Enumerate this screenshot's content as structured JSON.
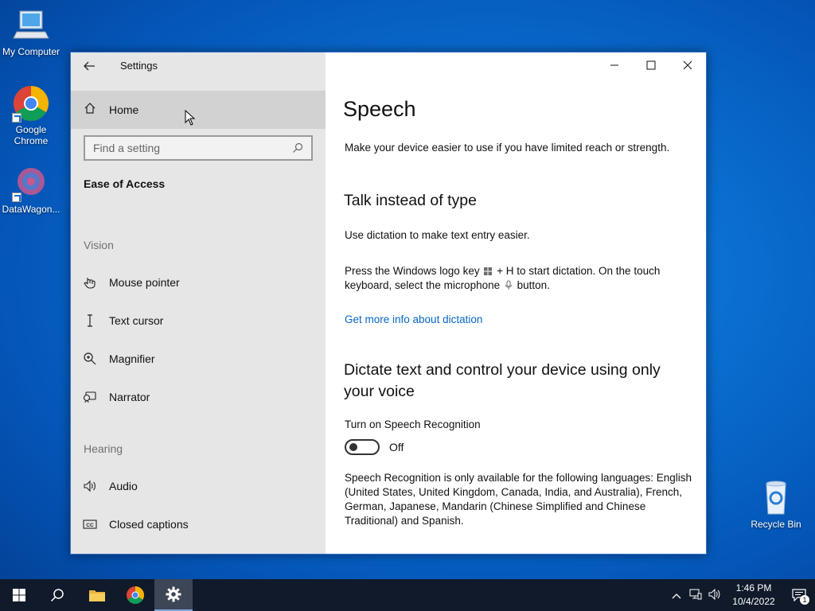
{
  "desktop": {
    "icons": [
      {
        "label": "My Computer",
        "icon": "computer-icon"
      },
      {
        "label": "Google Chrome",
        "icon": "chrome-icon"
      },
      {
        "label": "DataWagon...",
        "icon": "datawagon-icon"
      },
      {
        "label": "Recycle Bin",
        "icon": "recycle-bin-icon"
      }
    ]
  },
  "window": {
    "title": "Settings",
    "controls": [
      "minimize",
      "maximize",
      "close"
    ]
  },
  "sidebar": {
    "home_label": "Home",
    "search_placeholder": "Find a setting",
    "category": "Ease of Access",
    "groups": [
      {
        "label": "Vision",
        "items": [
          {
            "label": "Mouse pointer",
            "icon": "mouse-pointer-icon"
          },
          {
            "label": "Text cursor",
            "icon": "text-cursor-icon"
          },
          {
            "label": "Magnifier",
            "icon": "magnifier-icon"
          },
          {
            "label": "Narrator",
            "icon": "narrator-icon"
          }
        ]
      },
      {
        "label": "Hearing",
        "items": [
          {
            "label": "Audio",
            "icon": "audio-icon"
          },
          {
            "label": "Closed captions",
            "icon": "closed-captions-icon"
          }
        ]
      }
    ]
  },
  "main": {
    "title": "Speech",
    "subtitle": "Make your device easier to use if you have limited reach or strength.",
    "talk_heading": "Talk instead of type",
    "talk_desc": "Use dictation to make text entry easier.",
    "dictation_hint_1": "Press the Windows logo key",
    "dictation_hint_2": "+ H to start dictation.  On the touch keyboard, select the microphone",
    "dictation_hint_3": "button.",
    "dictation_link": "Get more info about dictation",
    "dictate_heading": "Dictate text and control your device using only your voice",
    "speech_recognition_label": "Turn on Speech Recognition",
    "speech_recognition_state": "Off",
    "speech_recognition_on": false,
    "languages_note": "Speech Recognition is only available for the following languages: English (United States, United Kingdom, Canada, India, and Australia), French, German, Japanese, Mandarin (Chinese Simplified and Chinese Traditional) and Spanish."
  },
  "taskbar": {
    "apps": [
      "start-icon",
      "search-icon",
      "file-explorer-icon",
      "chrome-icon",
      "settings-icon"
    ],
    "active_app": "settings-icon",
    "time": "1:46 PM",
    "date": "10/4/2022",
    "notification_count": "1"
  }
}
